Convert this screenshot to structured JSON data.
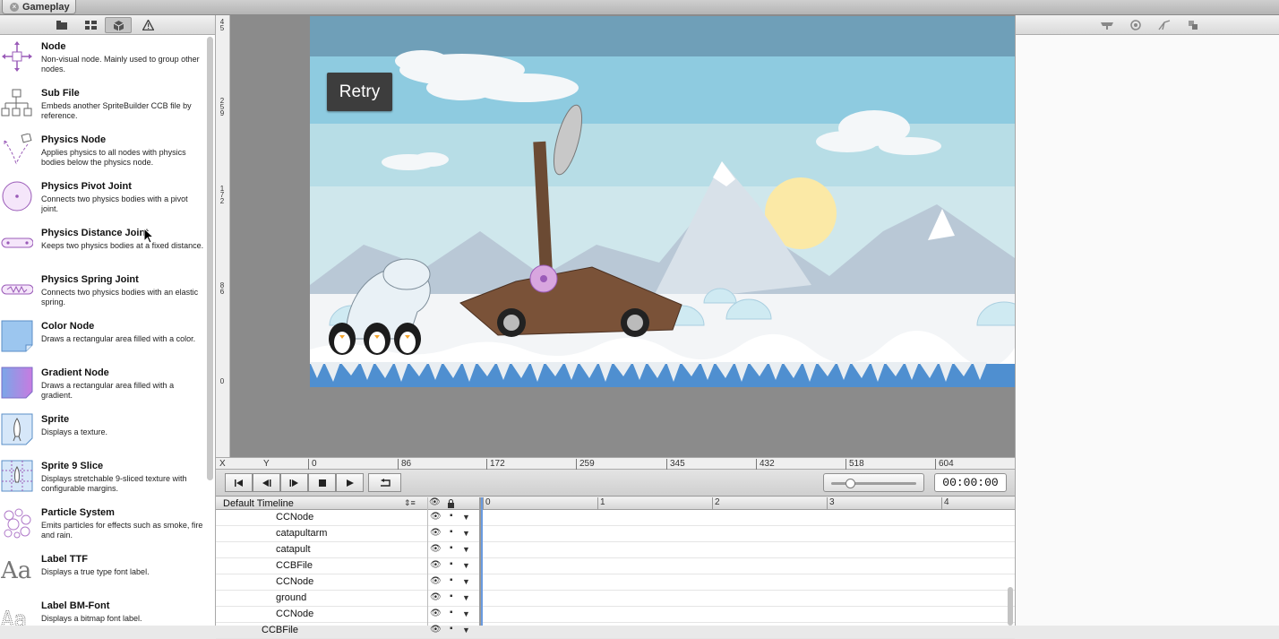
{
  "window": {
    "tab_title": "Gameplay"
  },
  "library": {
    "toolbar": [
      "nodes-folder-icon",
      "grid-icon",
      "box-icon",
      "warning-icon"
    ],
    "items": [
      {
        "title": "Node",
        "desc": "Non-visual node. Mainly used to group other nodes.",
        "icon": "node-icon"
      },
      {
        "title": "Sub File",
        "desc": "Embeds another SpriteBuilder CCB file by reference.",
        "icon": "sub-file-icon"
      },
      {
        "title": "Physics Node",
        "desc": "Applies physics to all nodes with physics bodies below the physics node.",
        "icon": "physics-node-icon"
      },
      {
        "title": "Physics Pivot Joint",
        "desc": "Connects two physics bodies with a pivot joint.",
        "icon": "pivot-joint-icon"
      },
      {
        "title": "Physics Distance Joint",
        "desc": "Keeps two physics bodies at a fixed distance.",
        "icon": "distance-joint-icon"
      },
      {
        "title": "Physics Spring Joint",
        "desc": "Connects two physics bodies with an elastic spring.",
        "icon": "spring-joint-icon"
      },
      {
        "title": "Color Node",
        "desc": "Draws a rectangular area filled with a color.",
        "icon": "color-node-icon"
      },
      {
        "title": "Gradient Node",
        "desc": "Draws a rectangular area filled with a gradient.",
        "icon": "gradient-node-icon"
      },
      {
        "title": "Sprite",
        "desc": "Displays a texture.",
        "icon": "sprite-icon"
      },
      {
        "title": "Sprite 9 Slice",
        "desc": "Displays stretchable 9-sliced texture with configurable margins.",
        "icon": "sprite-9-slice-icon"
      },
      {
        "title": "Particle System",
        "desc": "Emits particles for effects such as smoke, fire and rain.",
        "icon": "particle-system-icon"
      },
      {
        "title": "Label TTF",
        "desc": "Displays a true type font label.",
        "icon": "label-ttf-icon"
      },
      {
        "title": "Label BM-Font",
        "desc": "Displays a bitmap font label.",
        "icon": "label-bmfont-icon"
      }
    ]
  },
  "vruler": {
    "labels": [
      "4 5",
      "2 5 9",
      "1 7 2",
      "8 6",
      "0"
    ]
  },
  "scene": {
    "retry_label": "Retry"
  },
  "hruler": {
    "x_label": "X",
    "y_label": "Y",
    "ticks": [
      "0",
      "86",
      "172",
      "259",
      "345",
      "432",
      "518",
      "604"
    ]
  },
  "timeline": {
    "name": "Default Timeline",
    "timecode": "00:00:00",
    "scale": [
      "0",
      "1",
      "2",
      "3",
      "4"
    ],
    "rows": [
      {
        "name": "CCNode",
        "indent": 2
      },
      {
        "name": "catapultarm",
        "indent": 2
      },
      {
        "name": "catapult",
        "indent": 2
      },
      {
        "name": "CCBFile",
        "indent": 2
      },
      {
        "name": "CCNode",
        "indent": 2
      },
      {
        "name": "ground",
        "indent": 2
      },
      {
        "name": "CCNode",
        "indent": 2
      },
      {
        "name": "CCBFile",
        "indent": 1
      }
    ]
  },
  "colors": {
    "sky": "#94cfe0",
    "water": "#4f8fd0",
    "snow": "#f3f5f7",
    "accent": "#7b3fa0",
    "playhead": "#6a9be0"
  }
}
